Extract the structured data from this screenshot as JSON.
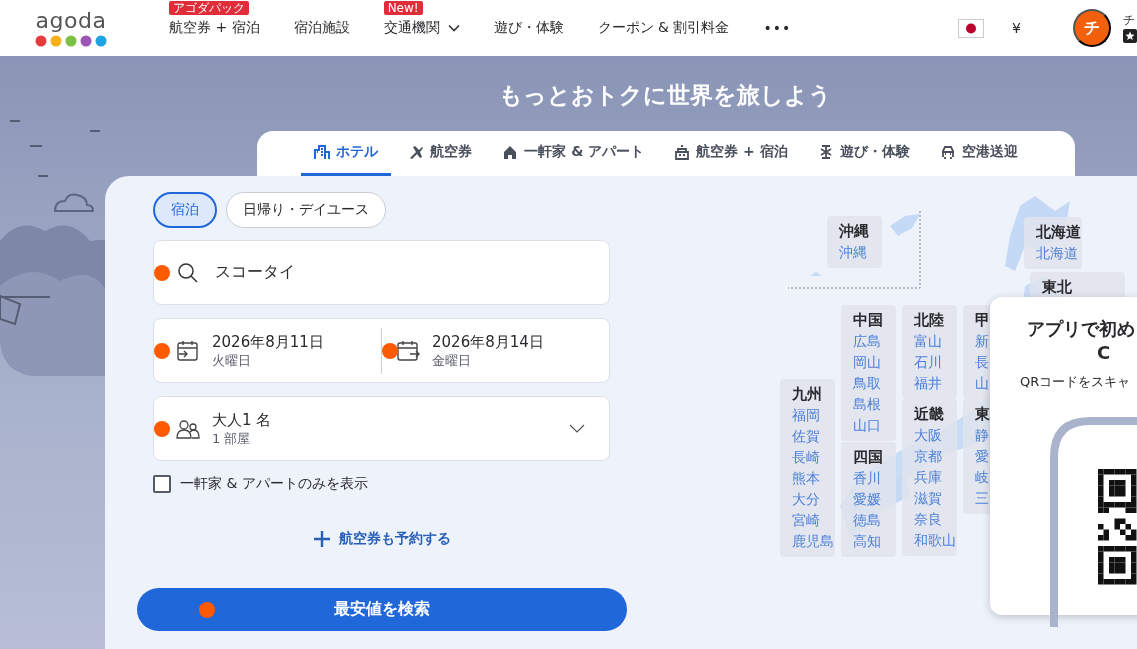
{
  "header": {
    "logo": "agoda",
    "nav": [
      {
        "label": "航空券 + 宿泊",
        "badge": "アゴダパック",
        "dropdown": false
      },
      {
        "label": "宿泊施設",
        "dropdown": false
      },
      {
        "label": "交通機関",
        "badge": "New!",
        "dropdown": true
      },
      {
        "label": "遊び・体験",
        "dropdown": false
      },
      {
        "label": "クーポン & 割引料金",
        "dropdown": false
      },
      {
        "label": "•••",
        "dropdown": false
      }
    ],
    "currency": "¥",
    "avatar": "チ",
    "user_name": "チ"
  },
  "hero": {
    "headline": "もっとおトクに世界を旅しよう"
  },
  "tabs": [
    {
      "label": "ホテル",
      "selected": true
    },
    {
      "label": "航空券",
      "selected": false
    },
    {
      "label": "一軒家 & アパート",
      "selected": false
    },
    {
      "label": "航空券 + 宿泊",
      "selected": false
    },
    {
      "label": "遊び・体験",
      "selected": false
    },
    {
      "label": "空港送迎",
      "selected": false
    }
  ],
  "stay_types": [
    {
      "label": "宿泊",
      "selected": true
    },
    {
      "label": "日帰り・デイユース",
      "selected": false
    }
  ],
  "search_field": {
    "value": "スコータイ",
    "marker": true
  },
  "dates": [
    {
      "date": "2026年8月11日",
      "weekday": "火曜日",
      "marker": true
    },
    {
      "date": "2026年8月14日",
      "weekday": "金曜日",
      "marker": true
    }
  ],
  "guests": {
    "adults": "大人1 名",
    "rooms": "1 部屋",
    "marker": true
  },
  "homes_only": {
    "label": "一軒家 & アパートのみを表示",
    "checked": false
  },
  "add_flight_link": "航空券も予約する",
  "search_button": {
    "label": "最安値を検索",
    "marker": true
  },
  "regions": [
    {
      "name": "沖縄",
      "items": [
        "沖縄"
      ]
    },
    {
      "name": "北海道",
      "items": [
        "北海道"
      ]
    },
    {
      "name": "東北"
    },
    {
      "name": "中国",
      "items": [
        "広島",
        "岡山",
        "鳥取",
        "島根",
        "山口"
      ]
    },
    {
      "name": "北陸",
      "items": [
        "富山",
        "石川",
        "福井"
      ]
    },
    {
      "name": "甲",
      "items": [
        "新",
        "長",
        "山"
      ]
    },
    {
      "name": "九州",
      "items": [
        "福岡",
        "佐賀",
        "長崎",
        "熊本",
        "大分",
        "宮崎",
        "鹿児島"
      ]
    },
    {
      "name": "四国",
      "items": [
        "香川",
        "愛媛",
        "徳島",
        "高知"
      ]
    },
    {
      "name": "近畿",
      "items": [
        "大阪",
        "京都",
        "兵庫",
        "滋賀",
        "奈良",
        "和歌山"
      ]
    },
    {
      "name": "東",
      "items": [
        "静",
        "愛",
        "岐",
        "三"
      ]
    }
  ],
  "app_popup": {
    "title_lines": [
      "アプリで初め",
      "C"
    ],
    "text": "QRコードをスキャ"
  }
}
